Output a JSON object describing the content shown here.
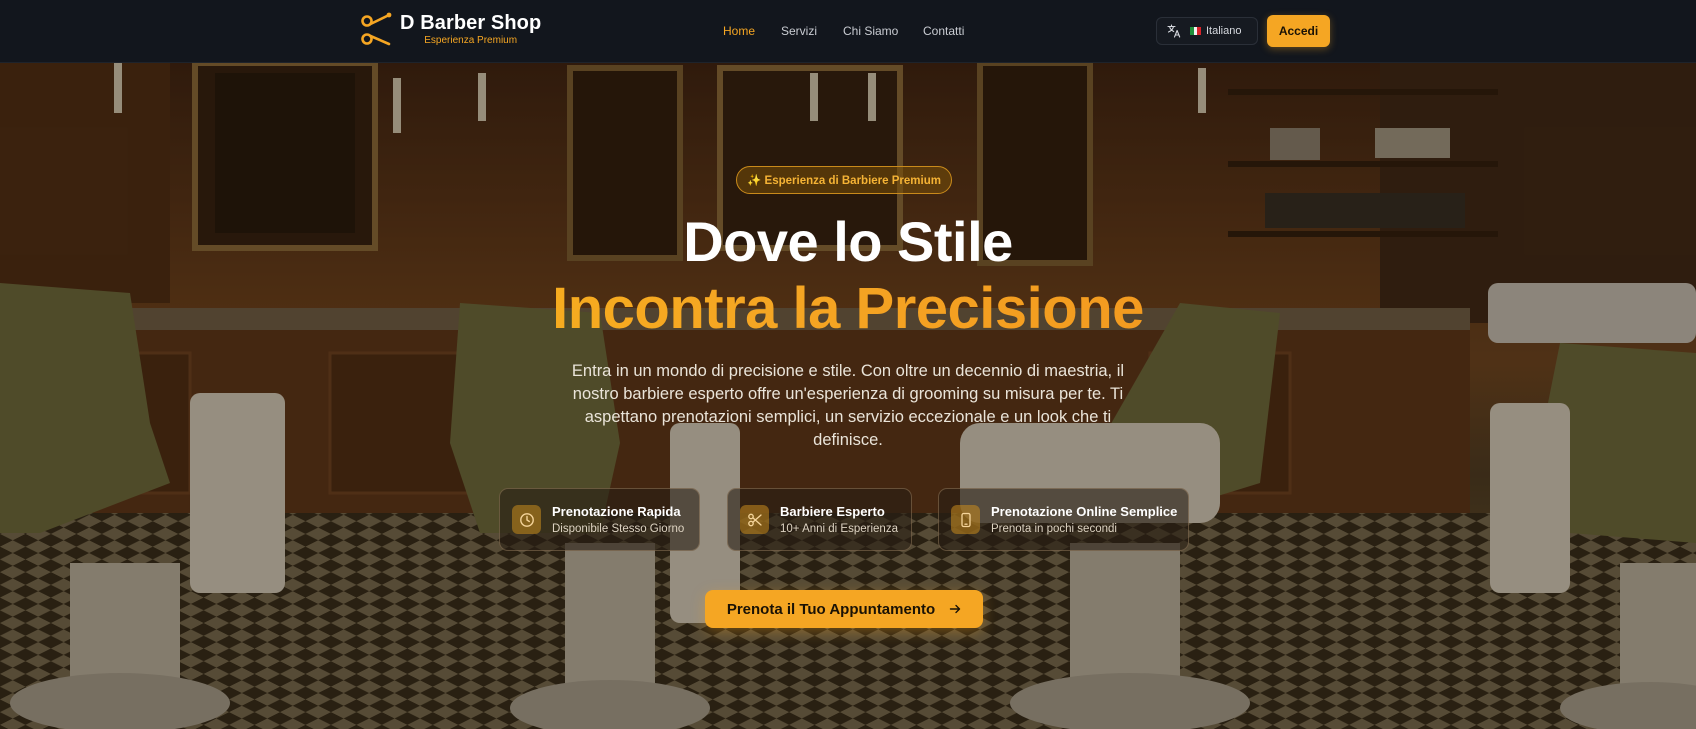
{
  "brand": {
    "name": "D Barber Shop",
    "tagline": "Esperienza Premium"
  },
  "nav": {
    "links": [
      {
        "label": "Home",
        "active": true
      },
      {
        "label": "Servizi",
        "active": false
      },
      {
        "label": "Chi Siamo",
        "active": false
      },
      {
        "label": "Contatti",
        "active": false
      }
    ]
  },
  "language": {
    "icon": "translate-icon",
    "flag": "italy-flag",
    "label": "Italiano"
  },
  "login": {
    "label": "Accedi"
  },
  "hero": {
    "badge": "✨ Esperienza di Barbiere Premium",
    "headline_line1": "Dove lo Stile",
    "headline_line2": "Incontra la Precisione",
    "description": "Entra in un mondo di precisione e stile. Con oltre un decennio di maestria, il nostro barbiere esperto offre un'esperienza di grooming su misura per te. Ti aspettano prenotazioni semplici, un servizio eccezionale e un look che ti definisce.",
    "features": [
      {
        "icon": "clock-icon",
        "title": "Prenotazione Rapida",
        "subtitle": "Disponibile Stesso Giorno"
      },
      {
        "icon": "scissors-icon",
        "title": "Barbiere Esperto",
        "subtitle": "10+ Anni di Esperienza"
      },
      {
        "icon": "smartphone-icon",
        "title": "Prenotazione Online Semplice",
        "subtitle": "Prenota in pochi secondi"
      }
    ],
    "cta": {
      "label": "Prenota il Tuo Appuntamento",
      "icon": "arrow-right-icon"
    }
  },
  "colors": {
    "accent": "#f5a623",
    "nav_bg": "#12161d",
    "text_primary": "#ffffff",
    "text_muted": "#c9ccd2"
  }
}
